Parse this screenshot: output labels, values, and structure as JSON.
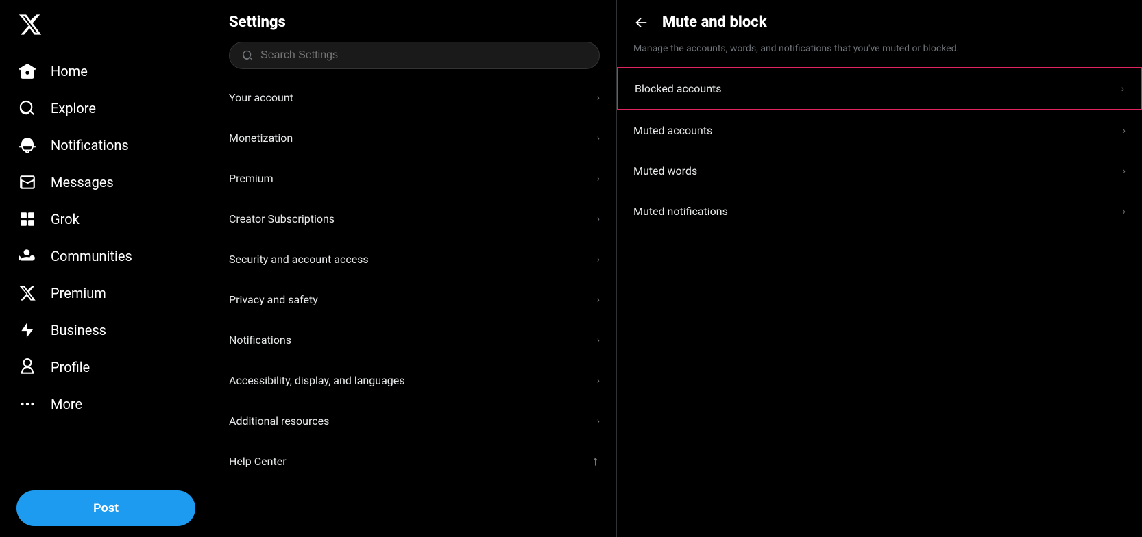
{
  "sidebar": {
    "logo_title": "X",
    "nav_items": [
      {
        "id": "home",
        "label": "Home",
        "icon": "home"
      },
      {
        "id": "explore",
        "label": "Explore",
        "icon": "search"
      },
      {
        "id": "notifications",
        "label": "Notifications",
        "icon": "bell"
      },
      {
        "id": "messages",
        "label": "Messages",
        "icon": "mail"
      },
      {
        "id": "grok",
        "label": "Grok",
        "icon": "grok"
      },
      {
        "id": "communities",
        "label": "Communities",
        "icon": "communities"
      },
      {
        "id": "premium",
        "label": "Premium",
        "icon": "x"
      },
      {
        "id": "business",
        "label": "Business",
        "icon": "bolt"
      },
      {
        "id": "profile",
        "label": "Profile",
        "icon": "person"
      },
      {
        "id": "more",
        "label": "More",
        "icon": "more"
      }
    ],
    "post_label": "Post"
  },
  "settings": {
    "title": "Settings",
    "search_placeholder": "Search Settings",
    "items": [
      {
        "id": "your-account",
        "label": "Your account",
        "type": "chevron"
      },
      {
        "id": "monetization",
        "label": "Monetization",
        "type": "chevron"
      },
      {
        "id": "premium",
        "label": "Premium",
        "type": "chevron"
      },
      {
        "id": "creator-subscriptions",
        "label": "Creator Subscriptions",
        "type": "chevron"
      },
      {
        "id": "security",
        "label": "Security and account access",
        "type": "chevron"
      },
      {
        "id": "privacy",
        "label": "Privacy and safety",
        "type": "chevron"
      },
      {
        "id": "notifications",
        "label": "Notifications",
        "type": "chevron"
      },
      {
        "id": "accessibility",
        "label": "Accessibility, display, and languages",
        "type": "chevron"
      },
      {
        "id": "additional",
        "label": "Additional resources",
        "type": "chevron"
      },
      {
        "id": "help",
        "label": "Help Center",
        "type": "external"
      }
    ]
  },
  "mute_block": {
    "title": "Mute and block",
    "subtitle": "Manage the accounts, words, and notifications that you've muted or blocked.",
    "items": [
      {
        "id": "blocked-accounts",
        "label": "Blocked accounts",
        "highlighted": true
      },
      {
        "id": "muted-accounts",
        "label": "Muted accounts",
        "highlighted": false
      },
      {
        "id": "muted-words",
        "label": "Muted words",
        "highlighted": false
      },
      {
        "id": "muted-notifications",
        "label": "Muted notifications",
        "highlighted": false
      }
    ]
  }
}
